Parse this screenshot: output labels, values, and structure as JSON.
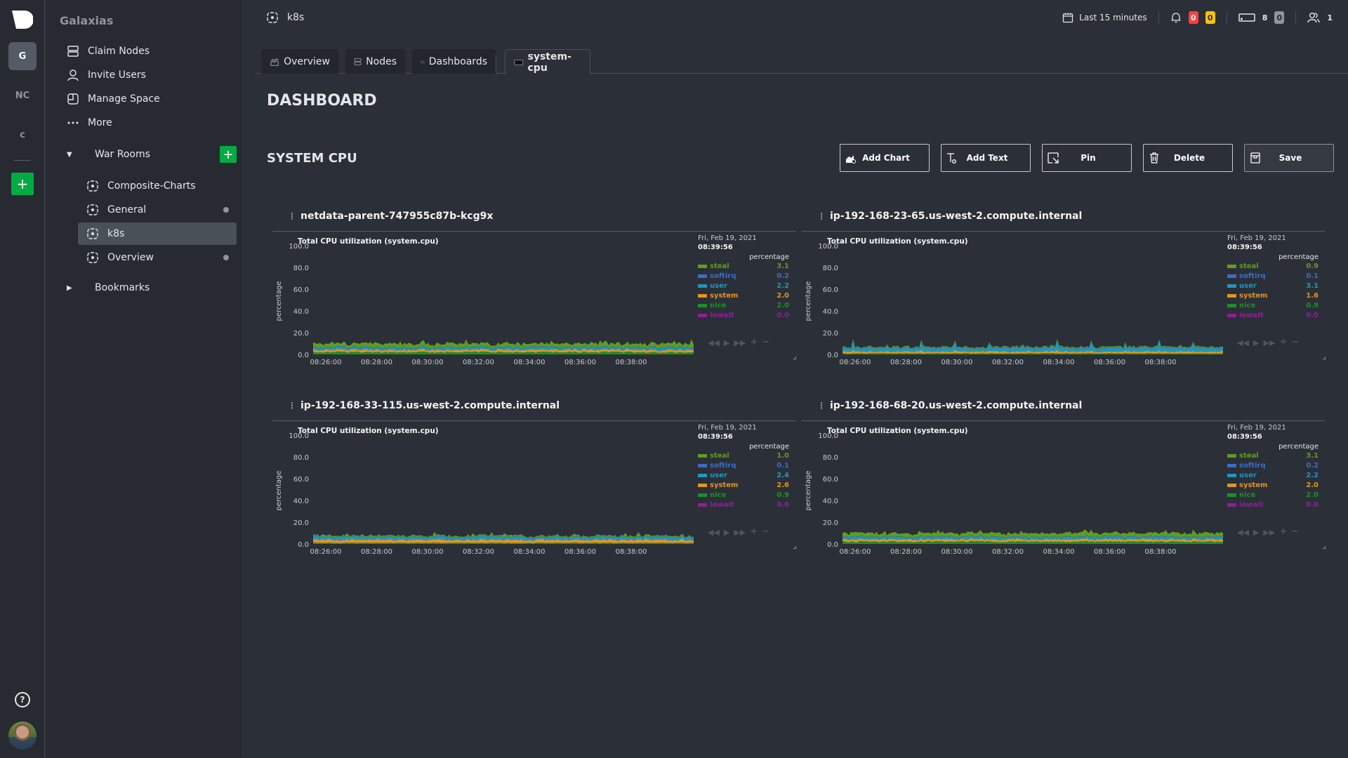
{
  "rail": {
    "spaces": [
      {
        "label": "G",
        "active": true
      },
      {
        "label": "NC",
        "active": false
      },
      {
        "label": "c",
        "active": false
      }
    ],
    "add_label": "+",
    "help_label": "?"
  },
  "sidebar": {
    "space_name": "Galaxias",
    "menu": [
      {
        "label": "Claim Nodes",
        "icon": "nodes-icon"
      },
      {
        "label": "Invite Users",
        "icon": "user-icon"
      },
      {
        "label": "Manage Space",
        "icon": "manage-space-icon"
      },
      {
        "label": "More",
        "icon": "more-icon"
      }
    ],
    "war_rooms_label": "War Rooms",
    "add_room_label": "+",
    "rooms": [
      {
        "label": "Composite-Charts",
        "active": false,
        "dot": false
      },
      {
        "label": "General",
        "active": false,
        "dot": true
      },
      {
        "label": "k8s",
        "active": true,
        "dot": false
      },
      {
        "label": "Overview",
        "active": false,
        "dot": true
      }
    ],
    "bookmarks_label": "Bookmarks"
  },
  "topbar": {
    "room_name": "k8s",
    "time_range": "Last 15 minutes",
    "alerts_critical": "0",
    "alerts_warning": "0",
    "nodes_live": "8",
    "nodes_offline": "0",
    "users": "1"
  },
  "tabs": [
    {
      "label": "Overview",
      "icon": "overview-icon"
    },
    {
      "label": "Nodes",
      "icon": "nodes-icon"
    },
    {
      "label": "Dashboards",
      "icon": "gauge-icon"
    },
    {
      "label": "system-cpu",
      "icon": "dashboard-icon",
      "active": true
    }
  ],
  "page_title": "DASHBOARD",
  "section_title": "SYSTEM CPU",
  "actions": {
    "add_chart": "Add Chart",
    "add_text": "Add Text",
    "pin": "Pin",
    "delete": "Delete",
    "save": "Save"
  },
  "colors": {
    "steal": "#5f9d1b",
    "softirq": "#3c6dc6",
    "user": "#1f96bf",
    "system": "#e39422",
    "nice": "#1f8e2c",
    "iowait": "#8e1f99",
    "accent": "#00ab44"
  },
  "chart_data": [
    {
      "type": "area",
      "node": "netdata-parent-747955c87b-kcg9x",
      "title": "Total CPU utilization (system.cpu)",
      "ylabel": "percentage",
      "unit": "percentage",
      "ylim": [
        0,
        100
      ],
      "yticks": [
        "100.0",
        "80.0",
        "60.0",
        "40.0",
        "20.0",
        "0.0"
      ],
      "xticks": [
        "08:26:00",
        "08:28:00",
        "08:30:00",
        "08:32:00",
        "08:34:00",
        "08:36:00",
        "08:38:00"
      ],
      "date": "Fri, Feb 19, 2021",
      "time": "08:39:56",
      "pattern": "noisy",
      "series": [
        {
          "name": "steal",
          "value": "3.1"
        },
        {
          "name": "softirq",
          "value": "0.2"
        },
        {
          "name": "user",
          "value": "2.2"
        },
        {
          "name": "system",
          "value": "2.0"
        },
        {
          "name": "nice",
          "value": "2.0"
        },
        {
          "name": "iowait",
          "value": "0.0"
        }
      ]
    },
    {
      "type": "area",
      "node": "ip-192-168-23-65.us-west-2.compute.internal",
      "title": "Total CPU utilization (system.cpu)",
      "ylabel": "percentage",
      "unit": "percentage",
      "ylim": [
        0,
        100
      ],
      "yticks": [
        "100.0",
        "80.0",
        "60.0",
        "40.0",
        "20.0",
        "0.0"
      ],
      "xticks": [
        "08:26:00",
        "08:28:00",
        "08:30:00",
        "08:32:00",
        "08:34:00",
        "08:36:00",
        "08:38:00"
      ],
      "date": "Fri, Feb 19, 2021",
      "time": "08:39:56",
      "pattern": "spiky",
      "series": [
        {
          "name": "steal",
          "value": "0.9"
        },
        {
          "name": "softirq",
          "value": "0.1"
        },
        {
          "name": "user",
          "value": "3.1"
        },
        {
          "name": "system",
          "value": "1.6"
        },
        {
          "name": "nice",
          "value": "0.9"
        },
        {
          "name": "iowait",
          "value": "0.0"
        }
      ]
    },
    {
      "type": "area",
      "node": "ip-192-168-33-115.us-west-2.compute.internal",
      "title": "Total CPU utilization (system.cpu)",
      "ylabel": "percentage",
      "unit": "percentage",
      "ylim": [
        0,
        100
      ],
      "yticks": [
        "100.0",
        "80.0",
        "60.0",
        "40.0",
        "20.0",
        "0.0"
      ],
      "xticks": [
        "08:26:00",
        "08:28:00",
        "08:30:00",
        "08:32:00",
        "08:34:00",
        "08:36:00",
        "08:38:00"
      ],
      "date": "Fri, Feb 19, 2021",
      "time": "08:39:56",
      "pattern": "noisy",
      "series": [
        {
          "name": "steal",
          "value": "1.0"
        },
        {
          "name": "softirq",
          "value": "0.1"
        },
        {
          "name": "user",
          "value": "2.4"
        },
        {
          "name": "system",
          "value": "2.6"
        },
        {
          "name": "nice",
          "value": "0.9"
        },
        {
          "name": "iowait",
          "value": "0.0"
        }
      ]
    },
    {
      "type": "area",
      "node": "ip-192-168-68-20.us-west-2.compute.internal",
      "title": "Total CPU utilization (system.cpu)",
      "ylabel": "percentage",
      "unit": "percentage",
      "ylim": [
        0,
        100
      ],
      "yticks": [
        "100.0",
        "80.0",
        "60.0",
        "40.0",
        "20.0",
        "0.0"
      ],
      "xticks": [
        "08:26:00",
        "08:28:00",
        "08:30:00",
        "08:32:00",
        "08:34:00",
        "08:36:00",
        "08:38:00"
      ],
      "date": "Fri, Feb 19, 2021",
      "time": "08:39:56",
      "pattern": "noisy",
      "series": [
        {
          "name": "steal",
          "value": "3.1"
        },
        {
          "name": "softirq",
          "value": "0.2"
        },
        {
          "name": "user",
          "value": "2.2"
        },
        {
          "name": "system",
          "value": "2.0"
        },
        {
          "name": "nice",
          "value": "2.0"
        },
        {
          "name": "iowait",
          "value": "0.0"
        }
      ]
    }
  ]
}
